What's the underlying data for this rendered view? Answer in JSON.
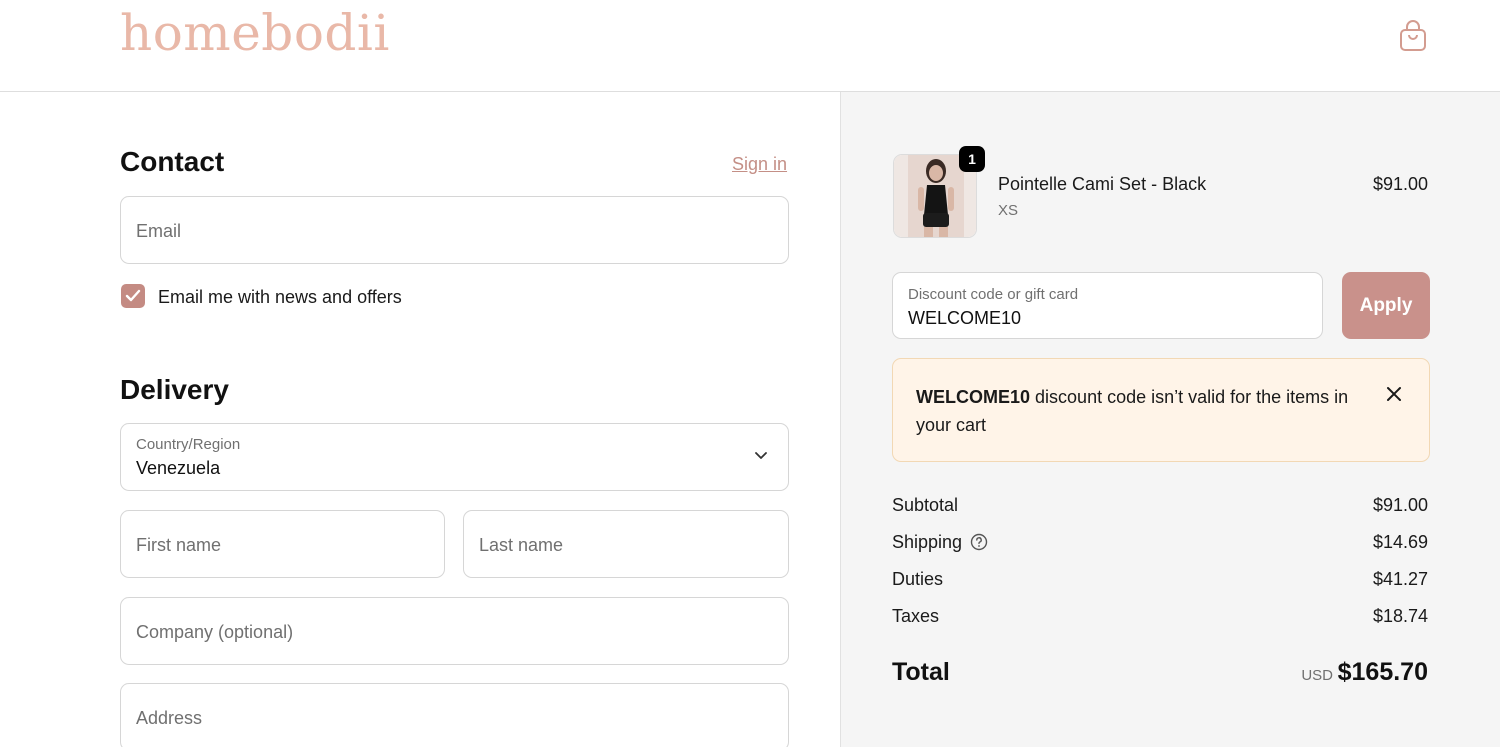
{
  "header": {
    "logo": "homebodii",
    "cart_icon": "shopping-bag-icon"
  },
  "contact": {
    "title": "Contact",
    "sign_in": "Sign in",
    "email_placeholder": "Email",
    "newsletter_label": "Email me with news and offers",
    "newsletter_checked": true
  },
  "delivery": {
    "title": "Delivery",
    "country_label": "Country/Region",
    "country_value": "Venezuela",
    "first_name_placeholder": "First name",
    "last_name_placeholder": "Last name",
    "company_placeholder": "Company (optional)",
    "address_placeholder": "Address"
  },
  "summary": {
    "product": {
      "name": "Pointelle Cami Set - Black",
      "variant": "XS",
      "price": "$91.00",
      "quantity": "1"
    },
    "discount": {
      "label": "Discount code or gift card",
      "value": "WELCOME10",
      "apply": "Apply"
    },
    "alert": {
      "code": "WELCOME10",
      "message": "discount code isn’t valid for the items in your cart"
    },
    "rows": [
      {
        "label": "Subtotal",
        "value": "$91.00"
      },
      {
        "label": "Shipping",
        "value": "$14.69"
      },
      {
        "label": "Duties",
        "value": "$41.27"
      },
      {
        "label": "Taxes",
        "value": "$18.74"
      }
    ],
    "total": {
      "label": "Total",
      "currency": "USD",
      "value": "$165.70"
    }
  },
  "colors": {
    "accent": "#c48b83",
    "logo": "#e9b8a8",
    "alert_bg": "#fff4e8"
  }
}
